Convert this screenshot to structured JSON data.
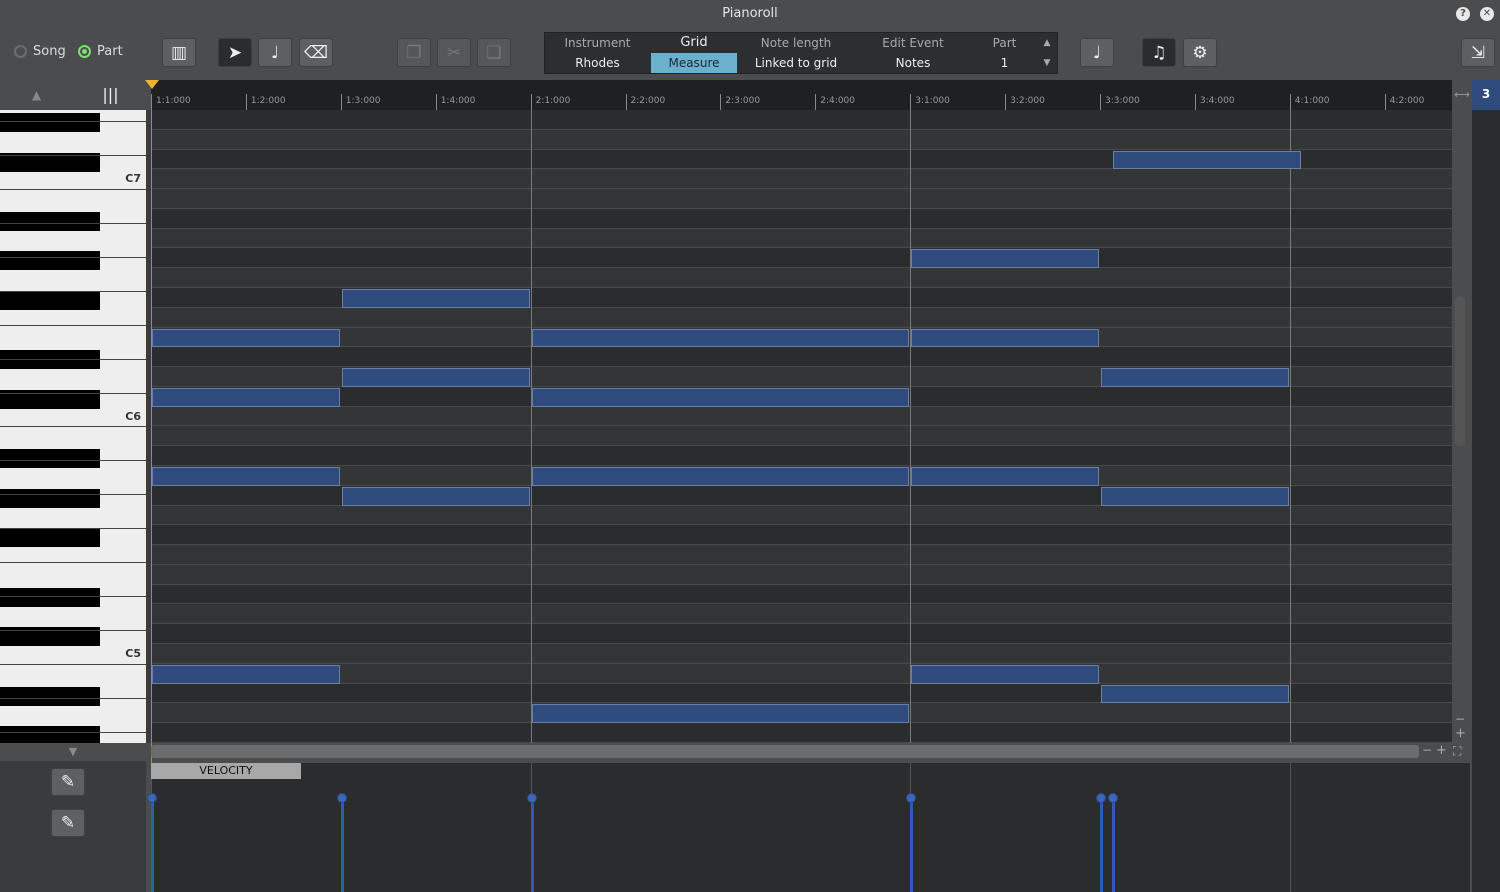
{
  "window": {
    "title": "Pianoroll",
    "help_icon": "question-icon",
    "close_icon": "close-icon"
  },
  "mode": {
    "song_label": "Song",
    "part_label": "Part",
    "selected": "Part"
  },
  "toolbar": {
    "tools": [
      "piano-keyboard",
      "pointer",
      "note-pencil",
      "eraser"
    ],
    "active_tool": "pointer",
    "edit": [
      "copy",
      "cut",
      "paste"
    ]
  },
  "info": {
    "headers": [
      "Instrument",
      "Grid",
      "Note length",
      "Edit Event",
      "Part"
    ],
    "values": [
      "Rhodes",
      "Measure",
      "Linked to grid",
      "Notes",
      "1"
    ],
    "highlighted": "Grid"
  },
  "right_tools": [
    "quantize",
    "add-note",
    "settings"
  ],
  "export_icon": "export-icon",
  "ruler": {
    "ticks": [
      "1:1:000",
      "1:2:000",
      "1:3:000",
      "1:4:000",
      "2:1:000",
      "2:2:000",
      "2:3:000",
      "2:4:000",
      "3:1:000",
      "3:2:000",
      "3:3:000",
      "3:4:000",
      "4:1:000",
      "4:2:000"
    ]
  },
  "track_badge": "3",
  "keyboard": {
    "labels": [
      "C7",
      "C6",
      "C5"
    ],
    "top_pitch": "D#7",
    "bottom_pitch": "G#4"
  },
  "notes_unit": "beats (4 per measure)",
  "notes": [
    {
      "pitch": "C#7",
      "start": 10.125,
      "length": 2
    },
    {
      "pitch": "G#6",
      "start": 8,
      "length": 2
    },
    {
      "pitch": "F#6",
      "start": 2,
      "length": 2
    },
    {
      "pitch": "E6",
      "start": 0,
      "length": 2
    },
    {
      "pitch": "E6",
      "start": 4,
      "length": 4
    },
    {
      "pitch": "E6",
      "start": 8,
      "length": 2
    },
    {
      "pitch": "D6",
      "start": 2,
      "length": 2
    },
    {
      "pitch": "D6",
      "start": 10,
      "length": 2
    },
    {
      "pitch": "C#6",
      "start": 0,
      "length": 2
    },
    {
      "pitch": "C#6",
      "start": 4,
      "length": 4
    },
    {
      "pitch": "A5",
      "start": 0,
      "length": 2
    },
    {
      "pitch": "A5",
      "start": 4,
      "length": 4
    },
    {
      "pitch": "A5",
      "start": 8,
      "length": 2
    },
    {
      "pitch": "G#5",
      "start": 2,
      "length": 2
    },
    {
      "pitch": "G#5",
      "start": 10,
      "length": 2
    },
    {
      "pitch": "B4",
      "start": 0,
      "length": 2
    },
    {
      "pitch": "B4",
      "start": 8,
      "length": 2
    },
    {
      "pitch": "A#4",
      "start": 10,
      "length": 2
    },
    {
      "pitch": "A4",
      "start": 4,
      "length": 4
    }
  ],
  "velocity": {
    "label": "VELOCITY",
    "value": 100,
    "max": 127
  },
  "colors": {
    "note": "#2f4a7c",
    "accent": "#6bb0cc",
    "velocity": "#2f5bb0",
    "playhead": "#f0b030"
  }
}
